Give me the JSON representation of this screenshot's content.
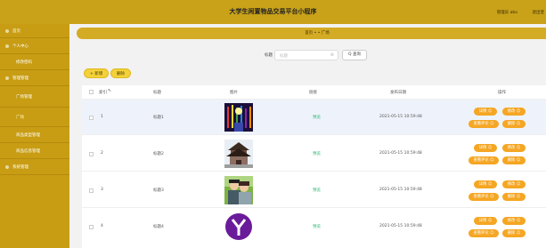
{
  "header": {
    "title": "大学生闲置物品交易平台小程序",
    "user": "管理员 abo",
    "logout": "退出登"
  },
  "sidebar": {
    "items": [
      {
        "label": "首页",
        "sub": false
      },
      {
        "label": "个人中心",
        "sub": false
      },
      {
        "label": "修改密码",
        "sub": true
      },
      {
        "label": "管理管理",
        "sub": false
      },
      {
        "label": "广场管理",
        "sub": true
      },
      {
        "label": "广场",
        "sub": true
      },
      {
        "label": "商品类型管理",
        "sub": true
      },
      {
        "label": "商品信息管理",
        "sub": true
      },
      {
        "label": "系统管理",
        "sub": false
      }
    ]
  },
  "breadcrumb": {
    "text": "首页 • • 广场"
  },
  "search": {
    "label": "标题",
    "placeholder": "标题",
    "button": "Q 查询"
  },
  "actions": {
    "add": "+ 新增",
    "delete": "删除"
  },
  "table": {
    "headers": [
      "索引",
      "标题",
      "图片",
      "链接",
      "发布日期",
      "操作"
    ],
    "rows": [
      {
        "index": "1",
        "title": "标题1",
        "link": "预览",
        "date": "2021-05-15 10:59:48"
      },
      {
        "index": "2",
        "title": "标题2",
        "link": "预览",
        "date": "2021-05-15 10:59:48"
      },
      {
        "index": "3",
        "title": "标题3",
        "link": "预览",
        "date": "2021-05-15 10:59:48"
      },
      {
        "index": "4",
        "title": "标题4",
        "link": "预览",
        "date": "2021-05-15 10:59:48"
      }
    ],
    "op_labels": {
      "detail": "详情 ☺",
      "edit": "修改 ☺",
      "comment": "查看评论 ☺",
      "delete": "删除 ☺"
    }
  },
  "colors": {
    "topbar": "#c9a21a",
    "sidebar": "#c89d14",
    "accent_button": "#f5a623",
    "yellow_button": "#f3d13a"
  }
}
